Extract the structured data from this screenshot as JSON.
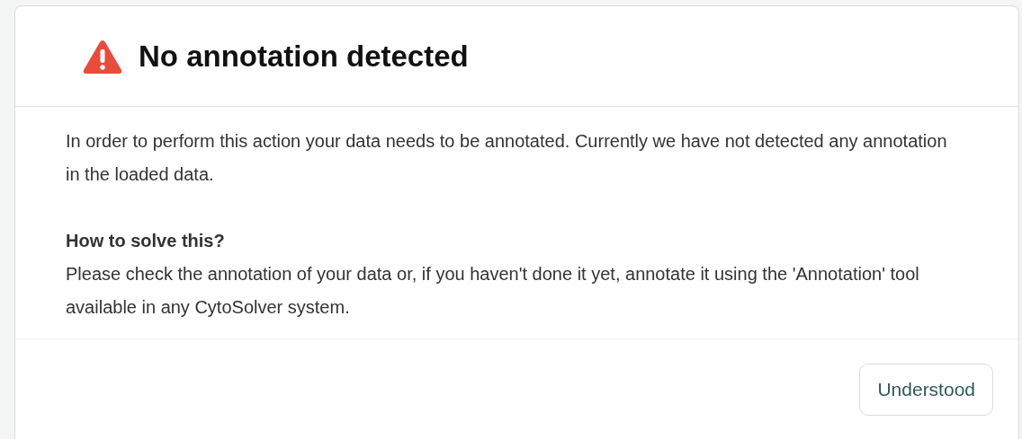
{
  "dialog": {
    "title": "No annotation detected",
    "message": "In order to perform this action your data needs to be annotated. Currently we have not detected any annotation in the loaded data.",
    "help_heading": "How to solve this?",
    "help_text": "Please check the annotation of your data or, if you haven't done it yet, annotate it using the 'Annotation' tool available in any CytoSolver system.",
    "buttons": [
      "Understood"
    ]
  }
}
